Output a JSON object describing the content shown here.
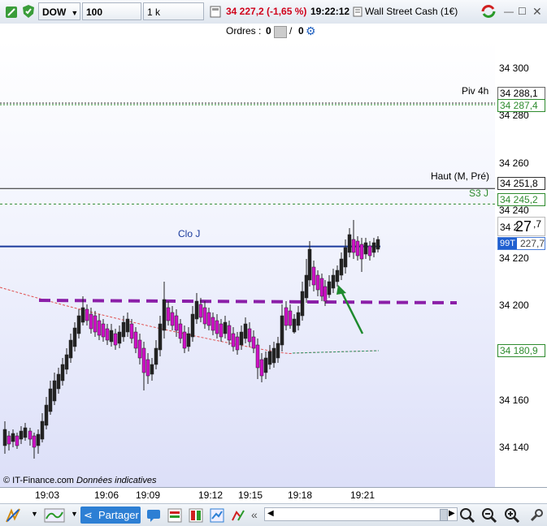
{
  "toolbar": {
    "instrument": "DOW",
    "period": "100 ticks",
    "quantity": "1 k unités",
    "price_change": "34 227,2 (-1,65 %)",
    "time": "19:22:12",
    "market": "Wall Street Cash (1€)"
  },
  "orders": {
    "label": "Ordres :",
    "count1": "0",
    "slash": "/",
    "count2": "0"
  },
  "chart": {
    "lines": {
      "piv4h_label": "Piv 4h",
      "piv4h_value": "34 288,1",
      "piv4h_value2": "34 287,4",
      "haut_label": "Haut (M, Pré)",
      "haut_value": "34 251,8",
      "s3_label": "S3 J",
      "s3_value": "34 245,2",
      "clo_label": "Clo J",
      "ma_value": "34 180,9"
    },
    "price_big": "27",
    "price_prefix": "34 2",
    "price_suffix": ",7",
    "ticks_label": "99T",
    "price_small": "227,7",
    "footer": "© IT-Finance.com",
    "footer_italic": "Données indicatives",
    "colors": {
      "bull": "#222222",
      "bear": "#d011c8",
      "pivot": "#2e8b2e",
      "clo": "#1a3a9c",
      "support": "#8b1fa8",
      "arrow": "#1e8a2e"
    }
  },
  "y_ticks": [
    "34 300",
    "34 280",
    "34 260",
    "34 240",
    "34 220",
    "34 200",
    "34 160",
    "34 140"
  ],
  "x_ticks": [
    "19:03",
    "19:06",
    "19:09",
    "19:12",
    "19:15",
    "19:18",
    "19:21"
  ],
  "bottom": {
    "share_label": "Partager"
  },
  "chart_data": {
    "type": "candlestick",
    "instrument": "DOW",
    "y_unit": "points",
    "ylim": [
      34125,
      34315
    ],
    "x_ticks": [
      "19:03",
      "19:06",
      "19:09",
      "19:12",
      "19:15",
      "19:18",
      "19:21"
    ],
    "levels": [
      {
        "name": "Piv 4h",
        "value": 34288.1
      },
      {
        "name": "Haut (M, Pré)",
        "value": 34251.8
      },
      {
        "name": "S3 J",
        "value": 34245.2
      },
      {
        "name": "Clo J",
        "value": 34227.2
      }
    ],
    "last_price": 34227.7
  }
}
